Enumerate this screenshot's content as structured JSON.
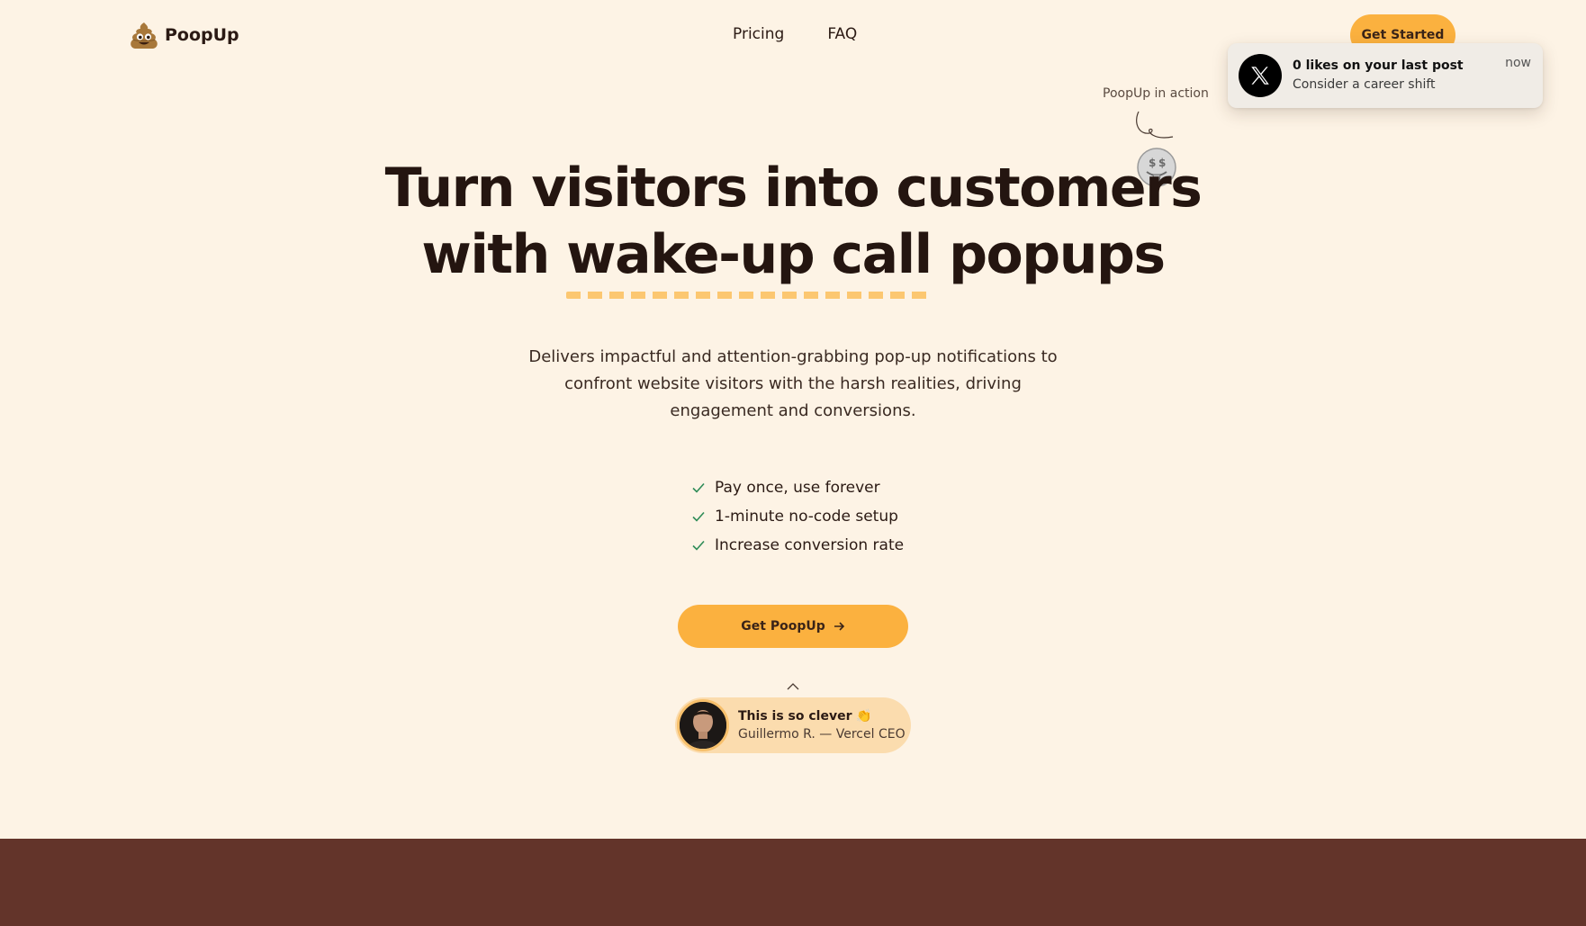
{
  "brand": {
    "name": "PoopUp",
    "logo_icon": "poop-emoji-icon"
  },
  "nav": {
    "items": [
      {
        "label": "Pricing"
      },
      {
        "label": "FAQ"
      }
    ],
    "cta_label": "Get Started"
  },
  "toast": {
    "icon": "x-logo-icon",
    "title": "0 likes on your last post",
    "subtitle": "Consider a career shift",
    "time": "now"
  },
  "annotation": {
    "label": "PoopUp in action",
    "emoji": "money-mouth-face-icon"
  },
  "hero": {
    "title_line1": "Turn visitors into customers",
    "title_line2_pre": "with ",
    "title_line2_highlight": "wake-up call",
    "title_line2_post": " popups",
    "subtitle": "Delivers impactful and attention-grabbing pop-up notifications to confront website visitors with the harsh realities, driving engagement and conversions.",
    "features": [
      "Pay once, use forever",
      "1-minute no-code setup",
      "Increase conversion rate"
    ],
    "cta_label": "Get PoopUp"
  },
  "testimonial": {
    "quote": "This is so clever 👏",
    "author": "Guillermo R. — Vercel CEO"
  },
  "colors": {
    "background": "#fdf3e5",
    "accent": "#fbb13f",
    "underline": "#fcc771",
    "dark_band": "#63342a",
    "check": "#2e8b57"
  }
}
